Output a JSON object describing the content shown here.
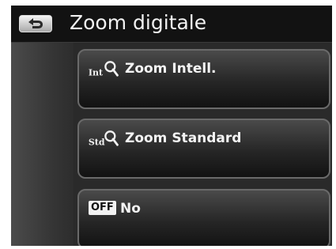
{
  "header": {
    "title": "Zoom digitale",
    "back_icon": "back-arrow-icon"
  },
  "options": [
    {
      "label": "Zoom Intell.",
      "icon": "intelligent-zoom-icon",
      "icon_text": "Int"
    },
    {
      "label": "Zoom Standard",
      "icon": "standard-zoom-icon",
      "icon_text": "Std"
    },
    {
      "label": "No",
      "icon": "off-icon",
      "icon_text": "OFF"
    }
  ],
  "colors": {
    "header_bg": "#121212",
    "panel_bg": "#2a2a2a",
    "option_border": "#6a6a6a",
    "text": "#f2f2f2"
  }
}
